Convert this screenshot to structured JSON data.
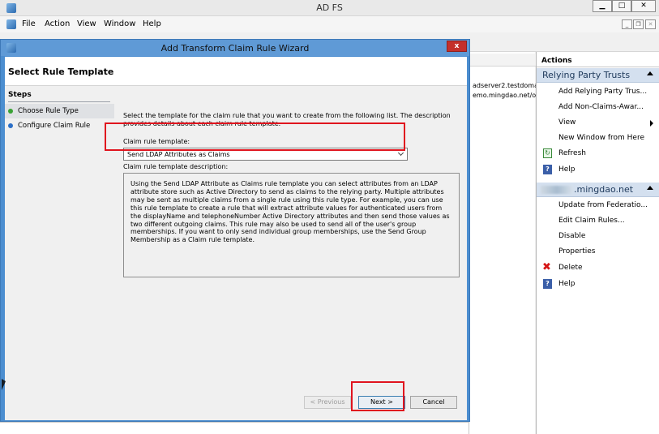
{
  "app": {
    "title": "AD FS",
    "menu": [
      "File",
      "Action",
      "View",
      "Window",
      "Help"
    ]
  },
  "mid": {
    "rows": [
      "adserver2.testdoma",
      "emo.mingdao.net/or"
    ]
  },
  "actions": {
    "title": "Actions",
    "section1": "Relying Party Trusts",
    "section1_items": [
      "Add Relying Party Trus...",
      "Add Non-Claims-Awar...",
      "View",
      "New Window from Here",
      "Refresh",
      "Help"
    ],
    "section2": ".mingdao.net",
    "section2_items": [
      "Update from Federatio...",
      "Edit Claim Rules...",
      "Disable",
      "Properties",
      "Delete",
      "Help"
    ]
  },
  "dialog": {
    "title": "Add Transform Claim Rule Wizard",
    "close": "x",
    "header": "Select Rule Template",
    "steps_title": "Steps",
    "steps": [
      "Choose Rule Type",
      "Configure Claim Rule"
    ],
    "intro": "Select the template for the claim rule that you want to create from the following list. The description provides details about each claim rule template.",
    "template_label": "Claim rule template:",
    "template_value": "Send LDAP Attributes as Claims",
    "description_label": "Claim rule template description:",
    "description": "Using the Send LDAP Attribute as Claims rule template you can select attributes from an LDAP attribute store such as Active Directory to send as claims to the relying party. Multiple attributes may be sent as multiple claims from a single rule using this rule type. For example, you can use this rule template to create a rule that will extract attribute values for authenticated users from the displayName and telephoneNumber Active Directory attributes and then send those values as two different outgoing claims. This rule may also be used to send all of the user's group memberships. If you want to only send individual group memberships, use the Send Group Membership as a Claim rule template.",
    "buttons": {
      "previous": "< Previous",
      "next": "Next >",
      "cancel": "Cancel"
    }
  },
  "colors": {
    "accent": "#5f9ad6",
    "highlight": "#e0141e",
    "section": "#d4e0ef"
  }
}
